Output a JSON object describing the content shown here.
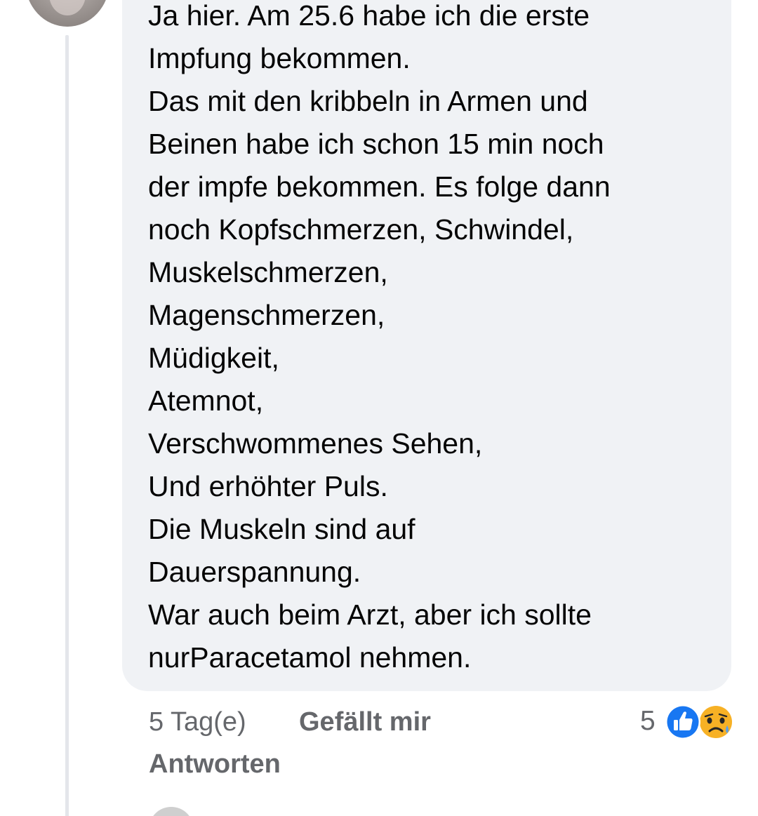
{
  "comment": {
    "lines": [
      "Ja hier. Am 25.6 habe ich die erste",
      "Impfung bekommen.",
      "Das mit den kribbeln in Armen und",
      "Beinen habe ich schon 15 min noch",
      "der impfe bekommen. Es folge dann",
      "noch Kopfschmerzen, Schwindel,",
      "Muskelschmerzen,",
      "Magenschmerzen,",
      "Müdigkeit,",
      "Atemnot,",
      "Verschwommenes Sehen,",
      "Und erhöhter Puls.",
      "Die Muskeln sind auf",
      "Dauerspannung.",
      "War auch beim Arzt, aber ich sollte",
      "nurParacetamol nehmen."
    ]
  },
  "actions": {
    "time_ago": "5 Tag(e)",
    "like_label": "Gefällt mir",
    "reply_label": "Antworten"
  },
  "reactions": {
    "count": "5",
    "icons": [
      "like-icon",
      "sad-icon"
    ],
    "like_color": "#1877f2",
    "sad_color": "#f7b125"
  },
  "colors": {
    "bubble_bg": "#f0f2f5",
    "text": "#050505",
    "secondary_text": "#65676b"
  }
}
